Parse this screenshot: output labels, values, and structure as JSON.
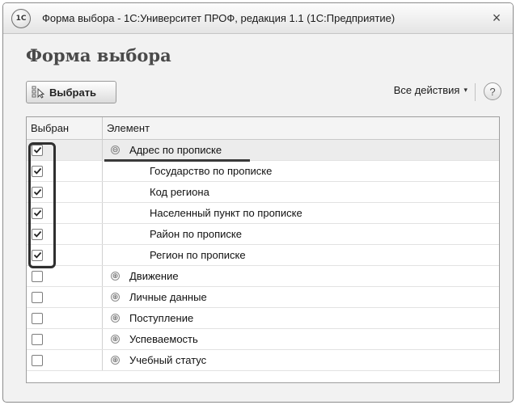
{
  "window": {
    "title": "Форма выбора - 1С:Университет ПРОФ, редакция 1.1  (1С:Предприятие)",
    "logo_text": "1С",
    "close_symbol": "×"
  },
  "form": {
    "title": "Форма выбора"
  },
  "toolbar": {
    "select_label": "Выбрать",
    "all_actions_label": "Все действия",
    "all_actions_caret": "▾",
    "help_symbol": "?"
  },
  "table": {
    "headers": {
      "selected": "Выбран",
      "element": "Элемент"
    },
    "rows": [
      {
        "checked": true,
        "level": 0,
        "expander": "⊖",
        "label": "Адрес по прописке",
        "selected": true
      },
      {
        "checked": true,
        "level": 1,
        "expander": "",
        "label": "Государство по прописке"
      },
      {
        "checked": true,
        "level": 1,
        "expander": "",
        "label": "Код региона"
      },
      {
        "checked": true,
        "level": 1,
        "expander": "",
        "label": "Населенный пункт по прописке"
      },
      {
        "checked": true,
        "level": 1,
        "expander": "",
        "label": "Район по прописке"
      },
      {
        "checked": true,
        "level": 1,
        "expander": "",
        "label": "Регион по прописке"
      },
      {
        "checked": false,
        "level": 0,
        "expander": "⊕",
        "label": "Движение"
      },
      {
        "checked": false,
        "level": 0,
        "expander": "⊕",
        "label": "Личные данные"
      },
      {
        "checked": false,
        "level": 0,
        "expander": "⊕",
        "label": "Поступление"
      },
      {
        "checked": false,
        "level": 0,
        "expander": "⊕",
        "label": "Успеваемость"
      },
      {
        "checked": false,
        "level": 0,
        "expander": "⊕",
        "label": "Учебный статус"
      }
    ]
  },
  "icons": {
    "app": "1c-logo-icon",
    "close": "close-icon",
    "select": "select-item-icon",
    "help": "help-icon",
    "expand": "plus-circle-icon",
    "collapse": "minus-circle-icon",
    "check": "checkmark-icon"
  }
}
